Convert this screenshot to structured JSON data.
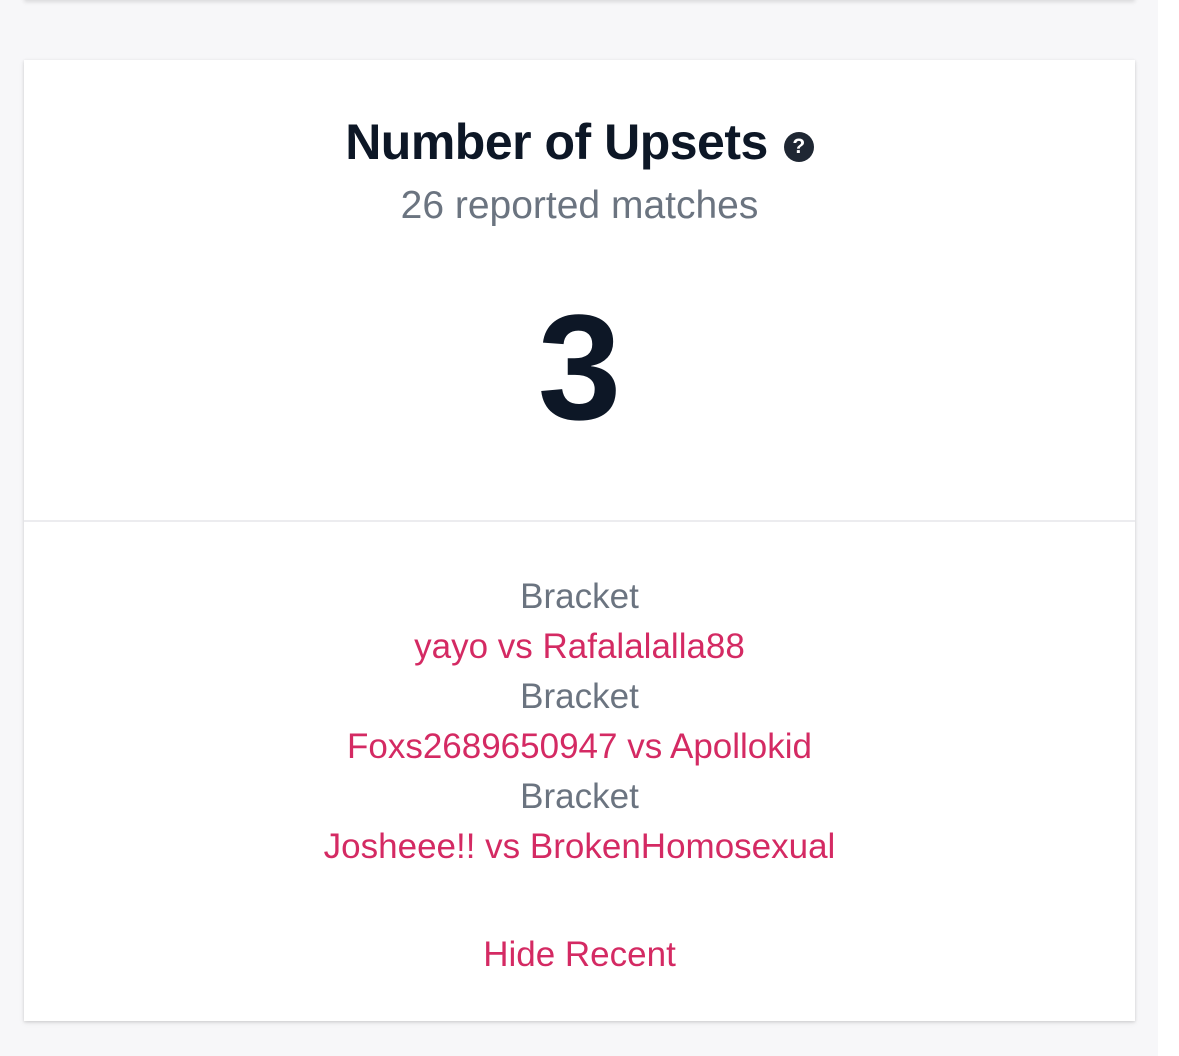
{
  "card": {
    "title": "Number of Upsets",
    "help_icon": "question-circle-icon",
    "subtitle": "26 reported matches",
    "value": "3"
  },
  "recent": {
    "items": [
      {
        "label": "Bracket",
        "match": "yayo vs Rafalalalla88"
      },
      {
        "label": "Bracket",
        "match": "Foxs2689650947 vs Apollokid"
      },
      {
        "label": "Bracket",
        "match": "Josheee!! vs BrokenHomosexual"
      }
    ],
    "toggle_label": "Hide Recent"
  },
  "colors": {
    "accent": "#d42a63",
    "title": "#0d1726",
    "muted": "#6b7480",
    "background": "#f7f7f9"
  }
}
